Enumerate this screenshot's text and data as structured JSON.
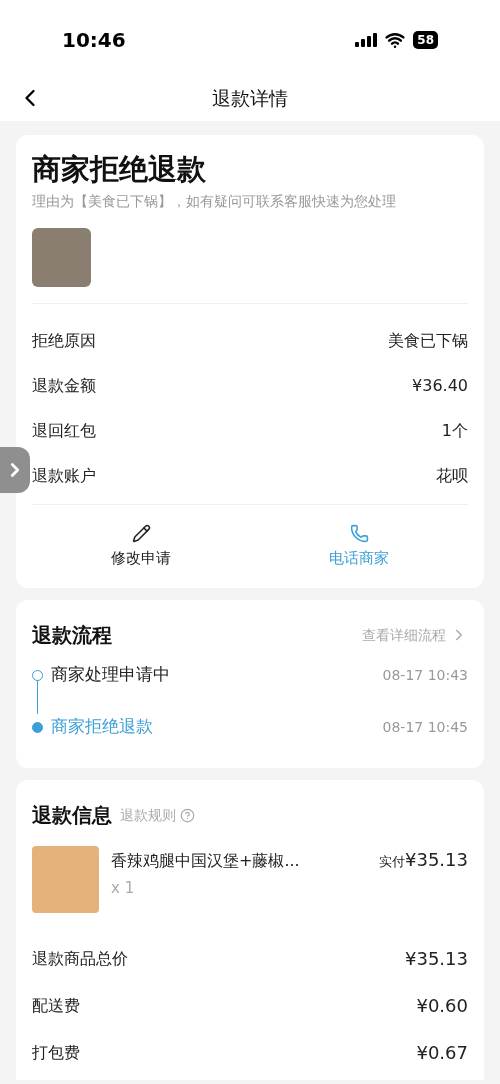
{
  "status_bar": {
    "time": "10:46",
    "battery": "58"
  },
  "nav": {
    "title": "退款详情"
  },
  "status_card": {
    "title": "商家拒绝退款",
    "subtitle": "理由为【美食已下锅】，如有疑问可联系客服快速为您处理",
    "details": [
      {
        "label": "拒绝原因",
        "value": "美食已下锅"
      },
      {
        "label": "退款金额",
        "value": "¥36.40"
      },
      {
        "label": "退回红包",
        "value": "1个"
      },
      {
        "label": "退款账户",
        "value": "花呗"
      }
    ],
    "actions": [
      {
        "kind": "edit",
        "label": "修改申请",
        "highlighted": false
      },
      {
        "kind": "phone",
        "label": "电话商家",
        "highlighted": true
      }
    ]
  },
  "process": {
    "title": "退款流程",
    "link": "查看详细流程",
    "steps": [
      {
        "label": "商家处理申请中",
        "time": "08-17 10:43",
        "current": false
      },
      {
        "label": "商家拒绝退款",
        "time": "08-17 10:45",
        "current": true
      }
    ]
  },
  "refund_info": {
    "title": "退款信息",
    "rules": "退款规则",
    "item": {
      "name": "香辣鸡腿中国汉堡+藤椒...",
      "qty": "x 1",
      "paid_label": "实付",
      "paid": "¥35.13"
    },
    "rows": [
      {
        "label": "退款商品总价",
        "value": "¥35.13"
      },
      {
        "label": "配送费",
        "value": "¥0.60"
      },
      {
        "label": "打包费",
        "value": "¥0.67"
      }
    ]
  }
}
